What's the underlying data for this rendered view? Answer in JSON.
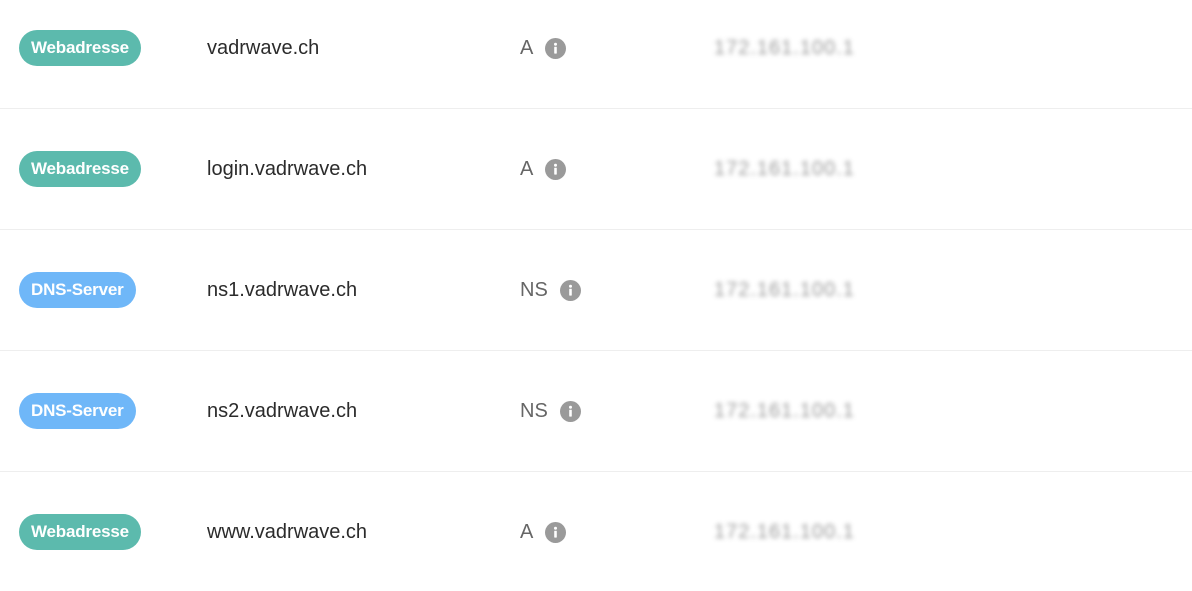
{
  "records": [
    {
      "category": "Webadresse",
      "category_kind": "web",
      "host": "vadrwave.ch",
      "type": "A",
      "value": "172.161.100.1"
    },
    {
      "category": "Webadresse",
      "category_kind": "web",
      "host": "login.vadrwave.ch",
      "type": "A",
      "value": "172.161.100.1"
    },
    {
      "category": "DNS-Server",
      "category_kind": "dns",
      "host": "ns1.vadrwave.ch",
      "type": "NS",
      "value": "172.161.100.1"
    },
    {
      "category": "DNS-Server",
      "category_kind": "dns",
      "host": "ns2.vadrwave.ch",
      "type": "NS",
      "value": "172.161.100.1"
    },
    {
      "category": "Webadresse",
      "category_kind": "web",
      "host": "www.vadrwave.ch",
      "type": "A",
      "value": "172.161.100.1"
    }
  ],
  "colors": {
    "web_badge": "#5cbaad",
    "dns_badge": "#6fb7f8",
    "info_icon": "#9a9a9a"
  },
  "icons": {
    "info": "info-icon"
  }
}
